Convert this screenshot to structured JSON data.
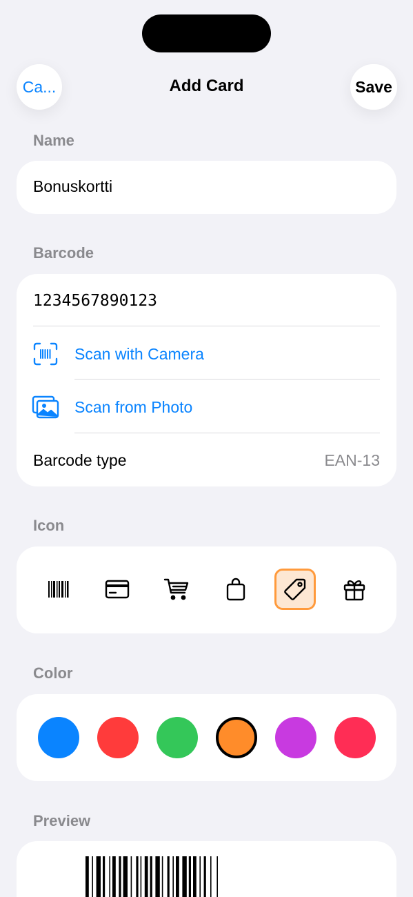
{
  "nav": {
    "cancel_label": "Ca...",
    "title": "Add Card",
    "save_label": "Save"
  },
  "name_section": {
    "label": "Name",
    "value": "Bonuskortti"
  },
  "barcode_section": {
    "label": "Barcode",
    "value": "1234567890123",
    "scan_camera_label": "Scan with Camera",
    "scan_photo_label": "Scan from Photo",
    "type_label": "Barcode type",
    "type_value": "EAN-13"
  },
  "icon_section": {
    "label": "Icon",
    "icons": [
      "barcode-icon",
      "credit-card-icon",
      "cart-icon",
      "shopping-bag-icon",
      "tag-icon",
      "gift-icon"
    ],
    "selected": "tag-icon"
  },
  "color_section": {
    "label": "Color",
    "colors": [
      "#0a84ff",
      "#ff3b3b",
      "#34c759",
      "#ff8c2a",
      "#c83ae0",
      "#ff2d55"
    ],
    "selected": "#ff8c2a"
  },
  "preview_section": {
    "label": "Preview"
  },
  "accent_color": "#0a84ff"
}
